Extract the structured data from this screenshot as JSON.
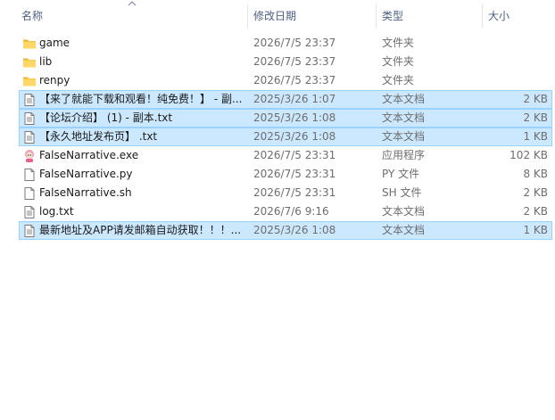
{
  "columns": {
    "name": "名称",
    "date": "修改日期",
    "type": "类型",
    "size": "大小"
  },
  "files": [
    {
      "name": "game",
      "date": "2026/7/5 23:37",
      "type": "文件夹",
      "size": "",
      "icon": "folder-icon",
      "selected": false
    },
    {
      "name": "lib",
      "date": "2026/7/5 23:37",
      "type": "文件夹",
      "size": "",
      "icon": "folder-icon",
      "selected": false
    },
    {
      "name": "renpy",
      "date": "2026/7/5 23:37",
      "type": "文件夹",
      "size": "",
      "icon": "folder-icon",
      "selected": false
    },
    {
      "name": "【来了就能下载和观看！纯免费！】 - 副...",
      "date": "2025/3/26 1:07",
      "type": "文本文档",
      "size": "2 KB",
      "icon": "text-document-icon",
      "selected": true
    },
    {
      "name": "【论坛介绍】 (1) - 副本.txt",
      "date": "2025/3/26 1:08",
      "type": "文本文档",
      "size": "2 KB",
      "icon": "text-document-icon",
      "selected": true
    },
    {
      "name": "【永久地址发布页】 .txt",
      "date": "2025/3/26 1:08",
      "type": "文本文档",
      "size": "1 KB",
      "icon": "text-document-icon",
      "selected": true
    },
    {
      "name": "FalseNarrative.exe",
      "date": "2026/7/5 23:31",
      "type": "应用程序",
      "size": "102 KB",
      "icon": "app-exe-icon",
      "selected": false
    },
    {
      "name": "FalseNarrative.py",
      "date": "2026/7/5 23:31",
      "type": "PY 文件",
      "size": "8 KB",
      "icon": "blank-file-icon",
      "selected": false
    },
    {
      "name": "FalseNarrative.sh",
      "date": "2026/7/5 23:31",
      "type": "SH 文件",
      "size": "2 KB",
      "icon": "blank-file-icon",
      "selected": false
    },
    {
      "name": "log.txt",
      "date": "2026/7/6 9:16",
      "type": "文本文档",
      "size": "2 KB",
      "icon": "text-document-icon",
      "selected": false
    },
    {
      "name": "最新地址及APP请发邮箱自动获取！！！...",
      "date": "2025/3/26 1:08",
      "type": "文本文档",
      "size": "1 KB",
      "icon": "text-document-icon",
      "selected": true
    }
  ],
  "colors": {
    "selection_bg": "#cce8ff",
    "selection_border": "#99d1ff",
    "header_text": "#4d6082",
    "folder": "#ffd766"
  }
}
